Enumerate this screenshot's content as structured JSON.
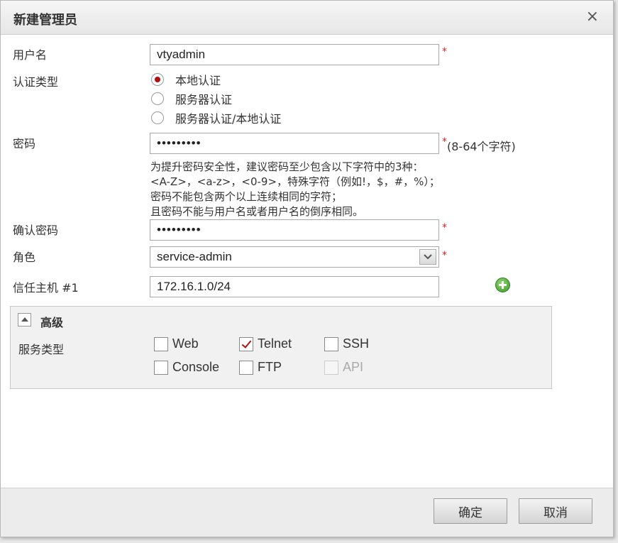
{
  "dialog": {
    "title": "新建管理员",
    "close_glyph": "×"
  },
  "form": {
    "username": {
      "label": "用户名",
      "value": "vtyadmin",
      "required_mark": "*"
    },
    "auth_type": {
      "label": "认证类型",
      "options": [
        "本地认证",
        "服务器认证",
        "服务器认证/本地认证"
      ],
      "selected": "本地认证"
    },
    "password": {
      "label": "密码",
      "value": "•••••••••",
      "required_mark": "*",
      "constraint": "(8-64个字符)",
      "hint_lines": [
        "为提升密码安全性，建议密码至少包含以下字符中的3种：",
        "<A-Z>，<a-z>，<0-9>，特殊字符（例如!，$，#，%）；",
        "密码不能包含两个以上连续相同的字符；",
        "且密码不能与用户名或者用户名的倒序相同。"
      ]
    },
    "confirm_password": {
      "label": "确认密码",
      "value": "•••••••••",
      "required_mark": "*"
    },
    "role": {
      "label": "角色",
      "value": "service-admin",
      "required_mark": "*"
    },
    "trusted_host": {
      "label": "信任主机 #1",
      "value": "172.16.1.0/24"
    }
  },
  "advanced": {
    "title": "高级",
    "service_type_label": "服务类型",
    "services": [
      {
        "label": "Web",
        "checked": false,
        "disabled": false
      },
      {
        "label": "Telnet",
        "checked": true,
        "disabled": false
      },
      {
        "label": "SSH",
        "checked": false,
        "disabled": false
      },
      {
        "label": "Console",
        "checked": false,
        "disabled": false
      },
      {
        "label": "FTP",
        "checked": false,
        "disabled": false
      },
      {
        "label": "API",
        "checked": false,
        "disabled": true
      }
    ]
  },
  "footer": {
    "ok_label": "确定",
    "cancel_label": "取消"
  },
  "icons": {
    "close": "close-icon",
    "select_arrow": "chevron-down-icon",
    "add": "plus-circle-icon",
    "collapse": "collapse-up-icon"
  },
  "colors": {
    "required": "#e02020",
    "check": "#b01010",
    "add_icon": "#3a9a28"
  }
}
